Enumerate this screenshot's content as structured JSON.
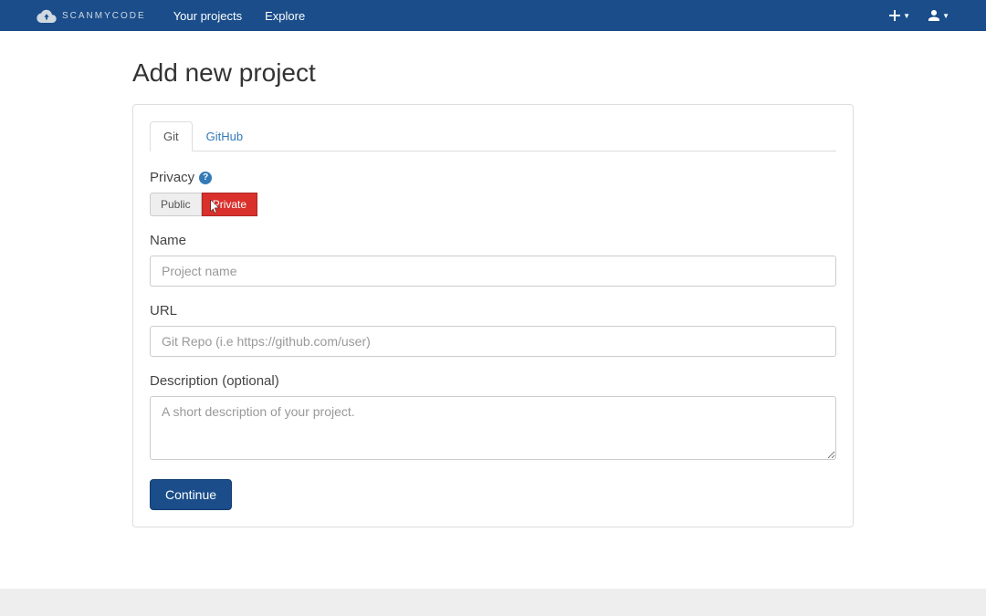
{
  "navbar": {
    "brand": "SCANMYCODE",
    "links": [
      "Your projects",
      "Explore"
    ]
  },
  "page": {
    "title": "Add new project"
  },
  "tabs": [
    {
      "label": "Git",
      "active": true
    },
    {
      "label": "GitHub",
      "active": false
    }
  ],
  "form": {
    "privacy": {
      "label": "Privacy",
      "options": [
        "Public",
        "Private"
      ],
      "selected": "Private"
    },
    "name": {
      "label": "Name",
      "placeholder": "Project name",
      "value": ""
    },
    "url": {
      "label": "URL",
      "placeholder": "Git Repo (i.e https://github.com/user)",
      "value": ""
    },
    "description": {
      "label": "Description (optional)",
      "placeholder": "A short description of your project.",
      "value": ""
    },
    "submit": "Continue"
  }
}
